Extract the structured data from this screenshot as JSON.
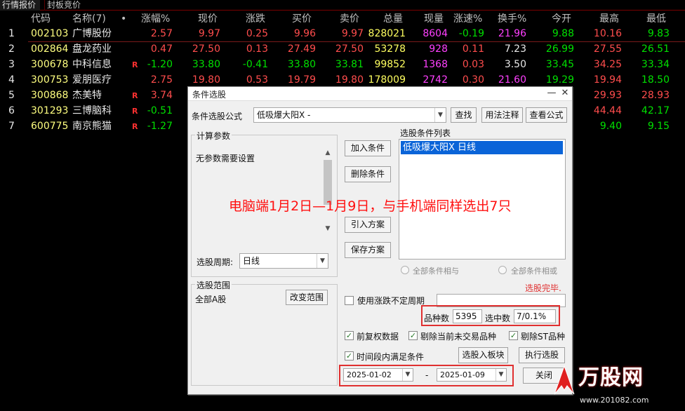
{
  "tabs": [
    "行情报价",
    "封板竞价"
  ],
  "headers": {
    "code": "代码",
    "name": "名称(7)",
    "dot": "•",
    "chg_pct": "涨幅%",
    "price": "现价",
    "chg": "涨跌",
    "bid": "买价",
    "ask": "卖价",
    "volume": "总量",
    "cur_vol": "现量",
    "speed": "涨速%",
    "turnover": "换手%",
    "open": "今开",
    "high": "最高",
    "low": "最低"
  },
  "rows": [
    {
      "idx": "1",
      "code": "002103",
      "name": "广博股份",
      "r": "",
      "chg_pct": "2.57",
      "price": "9.97",
      "chg": "0.25",
      "bid": "9.96",
      "ask": "9.97",
      "volume": "828021",
      "cur_vol": "8604",
      "speed": "-0.19",
      "turnover": "21.96",
      "open": "9.88",
      "high": "10.16",
      "low": "9.83"
    },
    {
      "idx": "2",
      "code": "002864",
      "name": "盘龙药业",
      "r": "",
      "chg_pct": "0.47",
      "price": "27.50",
      "chg": "0.13",
      "bid": "27.49",
      "ask": "27.50",
      "volume": "53278",
      "cur_vol": "928",
      "speed": "0.11",
      "turnover": "7.23",
      "open": "26.99",
      "high": "27.55",
      "low": "26.51"
    },
    {
      "idx": "3",
      "code": "300678",
      "name": "中科信息",
      "r": "R",
      "chg_pct": "-1.20",
      "price": "33.80",
      "chg": "-0.41",
      "bid": "33.80",
      "ask": "33.81",
      "volume": "99852",
      "cur_vol": "1368",
      "speed": "0.03",
      "turnover": "3.50",
      "open": "33.45",
      "high": "34.25",
      "low": "33.34"
    },
    {
      "idx": "4",
      "code": "300753",
      "name": "爱朋医疗",
      "r": "",
      "chg_pct": "2.75",
      "price": "19.80",
      "chg": "0.53",
      "bid": "19.79",
      "ask": "19.80",
      "volume": "178009",
      "cur_vol": "2742",
      "speed": "0.30",
      "turnover": "21.60",
      "open": "19.29",
      "high": "19.94",
      "low": "18.50"
    },
    {
      "idx": "5",
      "code": "300868",
      "name": "杰美特",
      "r": "R",
      "chg_pct": "3.74",
      "high": "29.93",
      "low": "28.93"
    },
    {
      "idx": "6",
      "code": "301293",
      "name": "三博脑科",
      "r": "R",
      "chg_pct": "-0.51",
      "high": "44.44",
      "low": "42.17"
    },
    {
      "idx": "7",
      "code": "600775",
      "name": "南京熊猫",
      "r": "R",
      "chg_pct": "-1.27",
      "high": "9.40",
      "low": "9.15"
    }
  ],
  "dialog": {
    "title": "条件选股",
    "formula_label": "条件选股公式",
    "formula_value": "低吸爆大阳X  -",
    "btn_find": "查找",
    "btn_usage": "用法注释",
    "btn_view": "查看公式",
    "calc_params_title": "计算参数",
    "no_params": "无参数需要设置",
    "btn_add": "加入条件",
    "btn_delete": "删除条件",
    "btn_import": "引入方案",
    "btn_save": "保存方案",
    "cond_list_title": "选股条件列表",
    "cond_list_item": "低吸爆大阳X  日线",
    "period_label": "选股周期:",
    "period_value": "日线",
    "radio_and": "全部条件相与",
    "radio_or": "全部条件相或",
    "status": "选股完毕.",
    "scope_title": "选股范围",
    "scope_value": "全部A股",
    "btn_change_scope": "改变范围",
    "chk_uncertain": "使用涨跌不定周期",
    "count_label": "品种数",
    "count_value": "5395",
    "selected_label": "选中数",
    "selected_value": "7/0.1%",
    "chk_prior": "前复权数据",
    "chk_exclude_inactive": "剔除当前未交易品种",
    "chk_exclude_st": "剔除ST品种",
    "chk_period": "时间段内满足条件",
    "btn_to_board": "选股入板块",
    "btn_execute": "执行选股",
    "date_from": "2025-01-02",
    "date_sep": "-",
    "date_to": "2025-01-09",
    "btn_close": "关闭"
  },
  "annotation": "电脑端1月2日—1月9日，与手机端同样选出7只",
  "watermark": {
    "logo": "万股网",
    "url": "www.201082.com"
  },
  "colors": {
    "up": "#ff4d4d",
    "down": "#00e000",
    "code": "#ffff80",
    "annotation": "#ff1010",
    "selection": "#0a64d8"
  }
}
